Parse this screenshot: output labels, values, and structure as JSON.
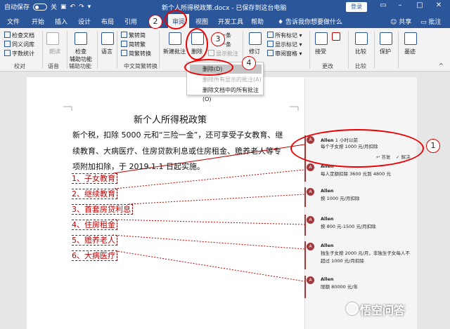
{
  "titlebar": {
    "autosave": "自动保存",
    "autosave_state": "关",
    "doc_title": "新个人所得税政策.docx - 已保存到这台电脑",
    "login": "登录"
  },
  "tabs": [
    "文件",
    "开始",
    "插入",
    "设计",
    "布局",
    "引用",
    "审阅",
    "视图",
    "开发工具",
    "帮助"
  ],
  "tell_me": "告诉我你想要做什么",
  "share": "共享",
  "comments_btn": "批注",
  "ribbon": {
    "proofing": [
      "检查文档",
      "同义词库",
      "字数统计"
    ],
    "proofing_label": "校对",
    "speech": "朗读",
    "speech_label": "语音",
    "accessibility": "检查\n辅助功能",
    "accessibility_label": "辅助功能",
    "language": "语言",
    "chinese_conv": [
      "繁转简",
      "简转繁",
      "简繁转换"
    ],
    "chinese_conv_label": "中文简繁转换",
    "new_comment": "新建批注",
    "delete": "删除",
    "prev": "上一条",
    "next": "下一条",
    "show_comments": "显示批注",
    "track": "修订",
    "all_markup": "所有标记",
    "show_markup": "显示标记",
    "review_pane": "审阅窗格",
    "accept": "接受",
    "changes_label": "更改",
    "compare": "比较",
    "compare_label": "比较",
    "protect": "保护",
    "ink": "墨迹"
  },
  "dropdown": [
    "删除(D)",
    "删除所有显示的批注(A)",
    "删除文档中的所有批注(O)"
  ],
  "document": {
    "heading": "新个人所得税政策",
    "para_lines": [
      "新个税，扣除 5000 元和“三险一金”，还可享受子女教育、继",
      "续教育、大病医疗、住房贷款利息或住房租金、赡养老人等专",
      "项附加扣除，于 2019.1.1 日起实施。"
    ],
    "items": [
      "1、子女教育",
      "2、继续教育",
      "3、首套房贷利息",
      "4、住房租金",
      "5、赡养老人",
      "6、大病医疗"
    ]
  },
  "comments": [
    {
      "author": "Allen",
      "time": "1 小时以前",
      "text": "每个子女按 1000 元/月扣除"
    },
    {
      "author": "Allen",
      "text": "每人定额扣除 3600 元到 4800 元"
    },
    {
      "author": "Allen",
      "text": "按 1000 元/月扣除"
    },
    {
      "author": "Allen",
      "text": "按 800 元-1500 元/月扣除"
    },
    {
      "author": "Allen",
      "text": "独生子女按 2000 元/月，非独生子女每人不超过 1000 元/月扣除"
    },
    {
      "author": "Allen",
      "text": "限额 80000 元/年"
    }
  ],
  "reply": "答复",
  "resolve": "解决",
  "badges": [
    "1",
    "2",
    "3",
    "4"
  ],
  "watermark": "悟空问答",
  "colors": {
    "accent": "#2b579a",
    "comment": "#a4373a",
    "annotation": "#e00000"
  }
}
